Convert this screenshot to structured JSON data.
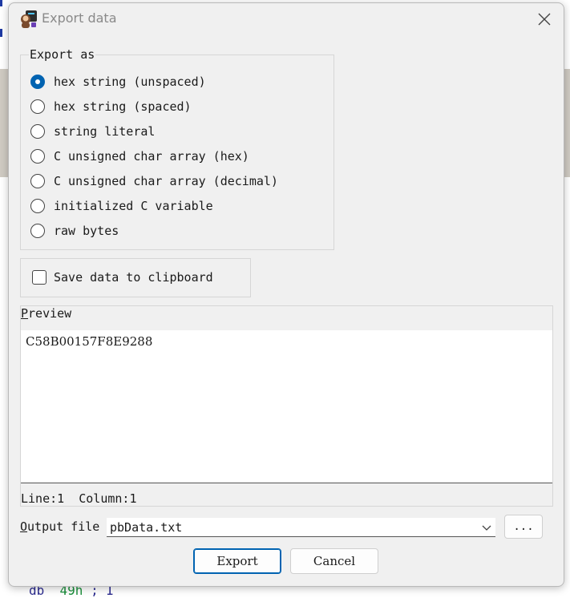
{
  "dialog": {
    "title": "Export data",
    "export_group": {
      "label": "Export as",
      "options": [
        {
          "label": "hex string (unspaced)",
          "checked": true
        },
        {
          "label": "hex string (spaced)",
          "checked": false
        },
        {
          "label": "string literal",
          "checked": false
        },
        {
          "label": "C unsigned char array (hex)",
          "checked": false
        },
        {
          "label": "C unsigned char array (decimal)",
          "checked": false
        },
        {
          "label": "initialized C variable",
          "checked": false
        },
        {
          "label": "raw bytes",
          "checked": false
        }
      ]
    },
    "clipboard": {
      "label": "Save data to clipboard",
      "checked": false
    },
    "preview": {
      "label_first": "P",
      "label_rest": "review",
      "content": "C58B00157F8E9288",
      "status": "Line:1  Column:1"
    },
    "output": {
      "label_first": "O",
      "label_rest": "utput file",
      "value": "pbData.txt",
      "browse_label": "..."
    },
    "buttons": {
      "export": "Export",
      "cancel": "Cancel"
    }
  },
  "background": {
    "code_prefix": "db",
    "code_value": "49h",
    "code_suffix": "; I"
  },
  "colors": {
    "accent": "#0063b1",
    "dialog_bg": "#f0f0f0"
  }
}
